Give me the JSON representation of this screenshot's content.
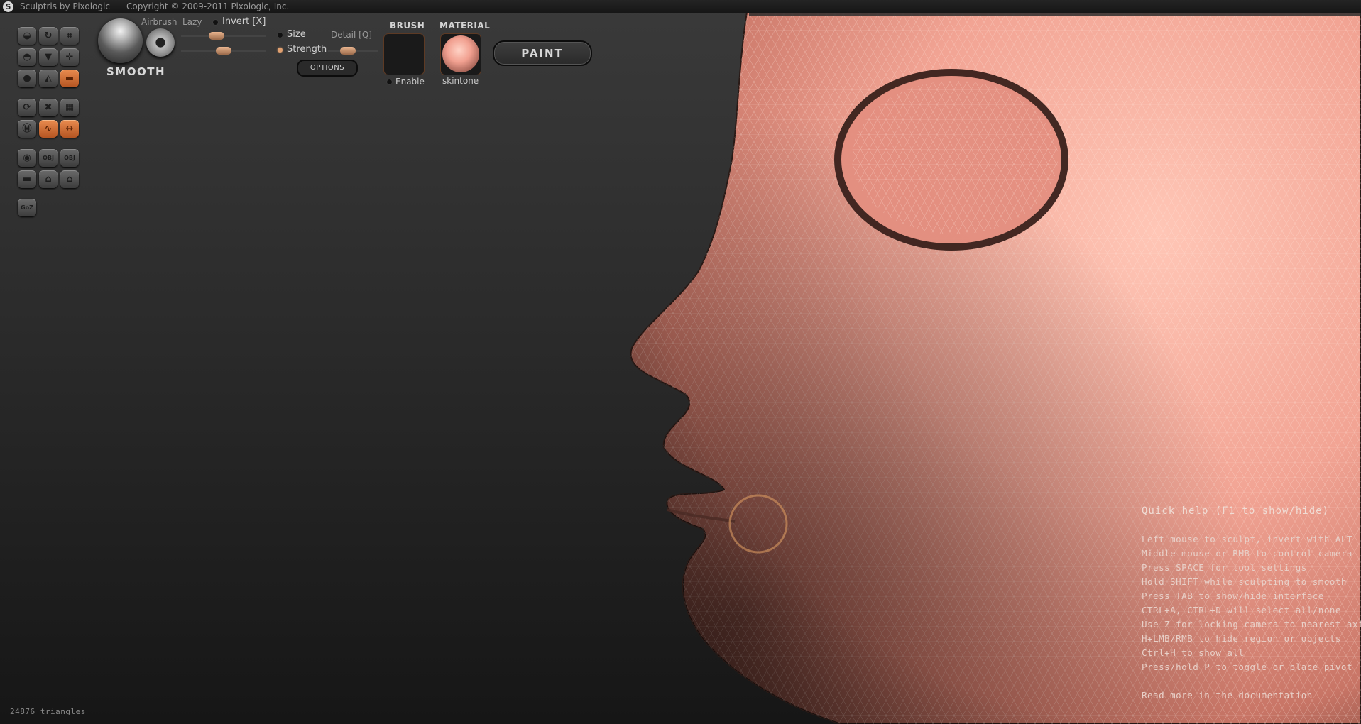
{
  "app": {
    "title": "Sculptris by Pixologic",
    "copyright": "Copyright © 2009-2011 Pixologic, Inc."
  },
  "toolbar": {
    "rows": [
      [
        {
          "name": "draw-tool",
          "icon": "draw-icon",
          "glyph": "◒",
          "active": false
        },
        {
          "name": "rotate-tool",
          "icon": "rotate-icon",
          "glyph": "↻",
          "active": false
        },
        {
          "name": "crop-tool",
          "icon": "crop-icon",
          "glyph": "⌗",
          "active": false
        }
      ],
      [
        {
          "name": "inflate-tool",
          "icon": "inflate-icon",
          "glyph": "◓",
          "active": false
        },
        {
          "name": "pinch-tool",
          "icon": "pinch-icon",
          "glyph": "▼",
          "active": false
        },
        {
          "name": "grab-tool",
          "icon": "move-icon",
          "glyph": "✛",
          "active": false
        }
      ],
      [
        {
          "name": "flatten-tool",
          "icon": "flatten-icon",
          "glyph": "●",
          "active": false
        },
        {
          "name": "crease-tool",
          "icon": "crease-icon",
          "glyph": "◭",
          "active": false
        },
        {
          "name": "smooth-tool",
          "icon": "smooth-icon",
          "glyph": "▬",
          "active": true
        }
      ],
      [
        {
          "name": "reduce-tool",
          "icon": "reduce-icon",
          "glyph": "⟳",
          "active": false
        },
        {
          "name": "mask-tool",
          "icon": "mask-icon",
          "glyph": "✖",
          "active": false
        },
        {
          "name": "wireframe-toggle",
          "icon": "wireframe-icon",
          "glyph": "▦",
          "active": false
        }
      ],
      [
        {
          "name": "symmetry-toggle",
          "icon": "symmetry-icon",
          "glyph": "Ⓜ",
          "active": false
        },
        {
          "name": "wave-toggle",
          "icon": "wave-icon",
          "glyph": "∿",
          "active": true
        },
        {
          "name": "mirror-toggle",
          "icon": "mirror-icon",
          "glyph": "↔",
          "active": true
        }
      ],
      [
        {
          "name": "sphere-object",
          "icon": "sphere-icon",
          "glyph": "◉",
          "active": false
        },
        {
          "name": "import-obj",
          "icon": "import-obj-icon",
          "glyph": "OBJ",
          "active": false
        },
        {
          "name": "export-obj",
          "icon": "export-obj-icon",
          "glyph": "OBJ",
          "active": false
        }
      ],
      [
        {
          "name": "plane-object",
          "icon": "plane-icon",
          "glyph": "▬",
          "active": false
        },
        {
          "name": "open-file",
          "icon": "open-icon",
          "glyph": "⌂",
          "active": false
        },
        {
          "name": "save-file",
          "icon": "save-icon",
          "glyph": "⌂",
          "active": false
        }
      ],
      [
        {
          "name": "goz-button",
          "icon": "goz-icon",
          "glyph": "GoZ",
          "active": false
        }
      ]
    ]
  },
  "brush": {
    "name": "SMOOTH",
    "airbrush_label": "Airbrush",
    "lazy_label": "Lazy",
    "invert_label": "Invert [X]",
    "size_label": "Size",
    "strength_label": "Strength",
    "detail_label": "Detail [Q]",
    "options_label": "OPTIONS",
    "size_value": 0.4,
    "strength_value": 0.5,
    "detail_value": 0.35
  },
  "brush_texture": {
    "header": "BRUSH",
    "enable_label": "Enable"
  },
  "material": {
    "header": "MATERIAL",
    "name": "skintone",
    "color": "#f2a494"
  },
  "paint_label": "PAINT",
  "quick_help": {
    "title": "Quick help (F1 to show/hide)",
    "lines": [
      "Left mouse to sculpt, invert with ALT",
      "Middle mouse or RMB to control camera",
      "Press SPACE for tool settings",
      "Hold SHIFT while sculpting to smooth",
      "Press TAB to show/hide interface",
      "CTRL+A, CTRL+D will select all/none",
      "Use Z for locking camera to nearest axis",
      "H+LMB/RMB to hide region or objects",
      "Ctrl+H to show all",
      "Press/hold P to toggle or place pivot"
    ],
    "footer": "Read more in the documentation"
  },
  "status": {
    "triangles": "24876 triangles"
  },
  "colors": {
    "accent": "#d9733a",
    "skin": "#f2a494"
  }
}
